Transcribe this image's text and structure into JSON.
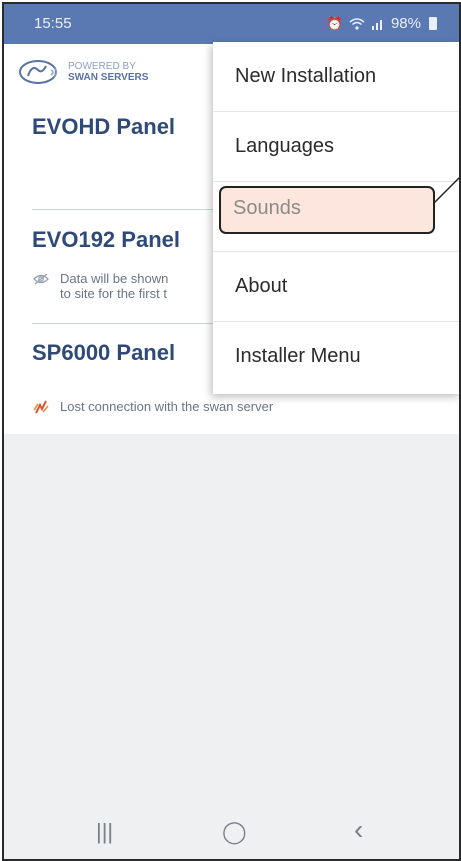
{
  "status_bar": {
    "time": "15:55",
    "alarm_icon": "alarm-clock-icon",
    "wifi_icon": "wifi-icon",
    "signal_icon": "signal-bars-icon",
    "battery": "98%",
    "background": "#5a79b3"
  },
  "brand": {
    "powered_by": "POWERED BY",
    "name": "SWAN SERVERS",
    "logo_icon": "swan-servers-logo"
  },
  "panels": [
    {
      "title": "EVOHD Panel",
      "note": ""
    },
    {
      "title": "EVO192 Panel",
      "note": "Data will be shown\nto site for the first t",
      "note_icon": "eye-off-icon"
    },
    {
      "title": "SP6000 Panel",
      "note": "Lost connection with the swan server",
      "note_icon": "connection-lost-icon"
    }
  ],
  "menu": {
    "items": [
      {
        "label": "New Installation"
      },
      {
        "label": "Languages"
      },
      {
        "label": "Sounds",
        "highlighted": true
      },
      {
        "label": "About"
      },
      {
        "label": "Installer Menu"
      }
    ],
    "highlight_color": "#fde6de"
  },
  "nav_bar": {
    "recents": "|||",
    "home": "◯",
    "back": "‹"
  }
}
